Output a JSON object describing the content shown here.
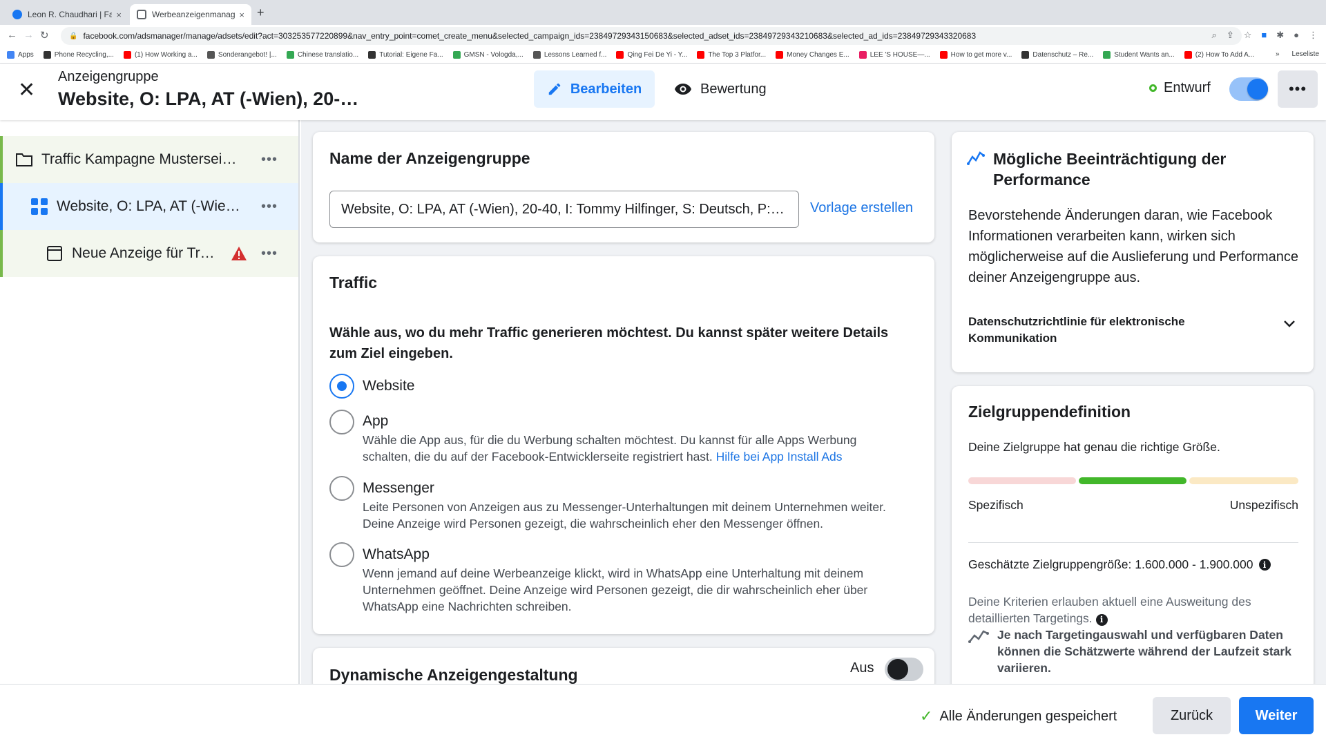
{
  "browser": {
    "tabs": [
      {
        "label": "Leon R. Chaudhari | Facebook",
        "close": "×",
        "fav_color": "#1877f2"
      },
      {
        "label": "Werbeanzeigenmanager - Wer…",
        "close": "×",
        "fav_color": "#5f6368"
      }
    ],
    "new_tab": "+",
    "url": "facebook.com/adsmanager/manage/adsets/edit?act=303253577220899&nav_entry_point=comet_create_menu&selected_campaign_ids=23849729343150683&selected_adset_ids=23849729343210683&selected_ad_ids=23849729343320683",
    "bookmarks": [
      {
        "label": "Apps",
        "color": "#4285f4"
      },
      {
        "label": "Phone Recycling,...",
        "color": "#333333"
      },
      {
        "label": "(1) How Working a...",
        "color": "#ff0000"
      },
      {
        "label": "Sonderangebot! |...",
        "color": "#555555"
      },
      {
        "label": "Chinese translatio...",
        "color": "#34a853"
      },
      {
        "label": "Tutorial: Eigene Fa...",
        "color": "#333333"
      },
      {
        "label": "GMSN - Vologda,...",
        "color": "#34a853"
      },
      {
        "label": "Lessons Learned f...",
        "color": "#555555"
      },
      {
        "label": "Qing Fei De Yi - Y...",
        "color": "#ff0000"
      },
      {
        "label": "The Top 3 Platfor...",
        "color": "#ff0000"
      },
      {
        "label": "Money Changes E...",
        "color": "#ff0000"
      },
      {
        "label": "LEE 'S HOUSE—...",
        "color": "#e91e63"
      },
      {
        "label": "How to get more v...",
        "color": "#ff0000"
      },
      {
        "label": "Datenschutz – Re...",
        "color": "#333333"
      },
      {
        "label": "Student Wants an...",
        "color": "#34a853"
      },
      {
        "label": "(2) How To Add A...",
        "color": "#ff0000"
      }
    ],
    "bookmarks_more": "»",
    "reading_list": "Leseliste"
  },
  "header": {
    "subtitle": "Anzeigengruppe",
    "title": "Website, O: LPA, AT (-Wien), 20-…",
    "edit_label": "Bearbeiten",
    "review_label": "Bewertung",
    "status_label": "Entwurf",
    "more": "•••"
  },
  "tree": {
    "campaign": "Traffic Kampagne Mustersei…",
    "adset": "Website, O: LPA, AT (-Wie…",
    "ad": "Neue Anzeige für Tr…",
    "dots": "•••"
  },
  "name_card": {
    "title": "Name der Anzeigengruppe",
    "value": "Website, O: LPA, AT (-Wien), 20-40, I: Tommy Hilfinger, S: Deutsch, P:…",
    "template_link": "Vorlage erstellen"
  },
  "traffic_card": {
    "title": "Traffic",
    "question": "Wähle aus, wo du mehr Traffic generieren möchtest. Du kannst später weitere Details zum Ziel eingeben.",
    "options": [
      {
        "label": "Website",
        "desc": "",
        "selected": true
      },
      {
        "label": "App",
        "desc": "Wähle die App aus, für die du Werbung schalten möchtest. Du kannst für alle Apps Werbung schalten, die du auf der Facebook-Entwicklerseite registriert hast.",
        "link": "Hilfe bei App Install Ads",
        "selected": false
      },
      {
        "label": "Messenger",
        "desc": "Leite Personen von Anzeigen aus zu Messenger-Unterhaltungen mit deinem Unternehmen weiter. Deine Anzeige wird Personen gezeigt, die wahrscheinlich eher den Messenger öffnen.",
        "selected": false
      },
      {
        "label": "WhatsApp",
        "desc": "Wenn jemand auf deine Werbeanzeige klickt, wird in WhatsApp eine Unterhaltung mit deinem Unternehmen geöffnet. Deine Anzeige wird Personen gezeigt, die dir wahrscheinlich eher über WhatsApp eine Nachrichten schreiben.",
        "selected": false
      }
    ]
  },
  "dynamic_card": {
    "title": "Dynamische Anzeigengestaltung",
    "toggle_label": "Aus"
  },
  "perf_card": {
    "title": "Mögliche Beeinträchtigung der Performance",
    "body": "Bevorstehende Änderungen daran, wie Facebook Informationen verarbeiten kann, wirken sich möglicherweise auf die Auslieferung und Performance deiner Anzeigengruppe aus.",
    "subheading": "Datenschutzrichtlinie für elektronische Kommunikation"
  },
  "audience_card": {
    "title": "Zielgruppendefinition",
    "status": "Deine Zielgruppe hat genau die richtige Größe.",
    "specific": "Spezifisch",
    "unspecific": "Unspezifisch",
    "size": "Geschätzte Zielgruppengröße: 1.600.000 - 1.900.000",
    "criteria": "Deine Kriterien erlauben aktuell eine Ausweitung des detaillierten Targetings.",
    "note": "Je nach Targetingauswahl und verfügbaren Daten können die Schätzwerte während der Laufzeit stark variieren.",
    "gauge_colors": [
      "#f8d7d7",
      "#42b72a",
      "#fbe9c4"
    ]
  },
  "footer": {
    "saved": "Alle Änderungen gespeichert",
    "back": "Zurück",
    "next": "Weiter"
  },
  "colors": {
    "accent": "#1877f2",
    "success": "#42b72a",
    "warning": "#d32f2f"
  }
}
